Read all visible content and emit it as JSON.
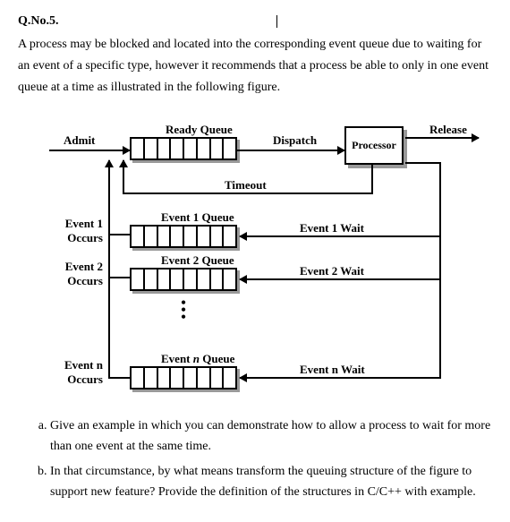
{
  "question_number": "Q.No.5.",
  "intro": "A process may be blocked and located into the corresponding event queue due to waiting for an event of a specific type, however it recommends that a process be able to only in one event queue at a time as illustrated in the following figure.",
  "diagram": {
    "admit": "Admit",
    "ready_queue": "Ready Queue",
    "dispatch": "Dispatch",
    "processor": "Processor",
    "release": "Release",
    "timeout": "Timeout",
    "events": [
      {
        "occurs": "Event 1 Occurs",
        "queue": "Event 1 Queue",
        "wait": "Event 1 Wait"
      },
      {
        "occurs": "Event 2 Occurs",
        "queue": "Event 2 Queue",
        "wait": "Event 2 Wait"
      },
      {
        "occurs": "Event n Occurs",
        "queue": "Event n Queue",
        "wait": "Event n Wait"
      }
    ],
    "event_n_queue_raw": "Event n Queue"
  },
  "parts": {
    "a": "Give an example in which you can demonstrate how to allow a process to wait for more than one event at the same time.",
    "b": "In that circumstance, by what means transform the queuing structure of the figure to support new feature? Provide the definition of the structures in C/C++ with example."
  }
}
